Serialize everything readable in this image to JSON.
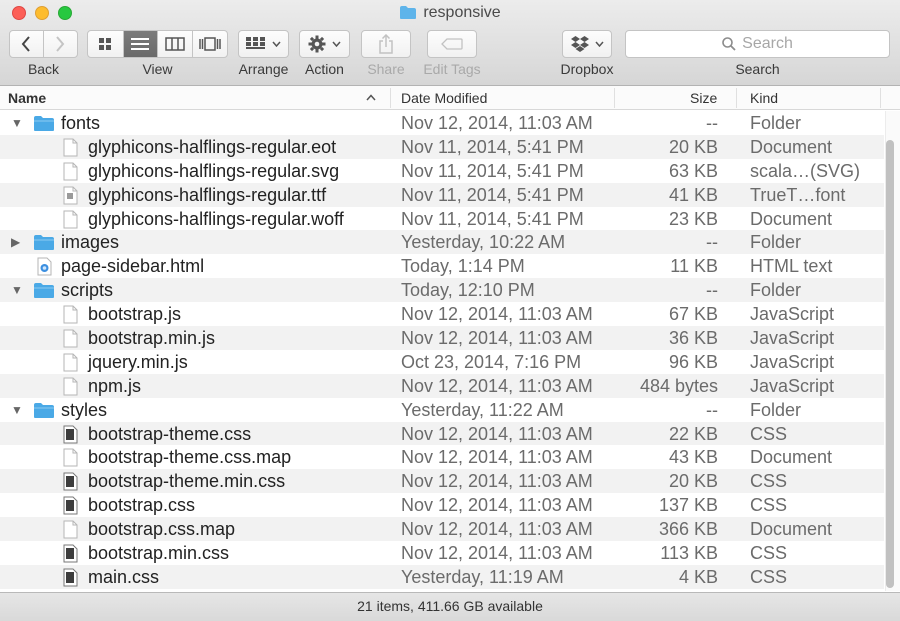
{
  "window": {
    "title": "responsive"
  },
  "toolbar": {
    "back_label": "Back",
    "view_label": "View",
    "arrange_label": "Arrange",
    "action_label": "Action",
    "share_label": "Share",
    "edit_tags_label": "Edit Tags",
    "dropbox_label": "Dropbox",
    "search_label": "Search",
    "search_placeholder": "Search",
    "view_mode_selected": "list"
  },
  "columns": {
    "name": "Name",
    "date_modified": "Date Modified",
    "size": "Size",
    "kind": "Kind",
    "sort": "name-ascending"
  },
  "rows": [
    {
      "name": "fonts",
      "date": "Nov 12, 2014, 11:03 AM",
      "size": "--",
      "kind": "Folder",
      "icon": "folder-icon",
      "depth": 0,
      "expanded": true
    },
    {
      "name": "glyphicons-halflings-regular.eot",
      "date": "Nov 11, 2014, 5:41 PM",
      "size": "20 KB",
      "kind": "Document",
      "icon": "document-icon",
      "depth": 1
    },
    {
      "name": "glyphicons-halflings-regular.svg",
      "date": "Nov 11, 2014, 5:41 PM",
      "size": "63 KB",
      "kind": "scala…(SVG)",
      "icon": "document-icon",
      "depth": 1
    },
    {
      "name": "glyphicons-halflings-regular.ttf",
      "date": "Nov 11, 2014, 5:41 PM",
      "size": "41 KB",
      "kind": "TrueT…font",
      "icon": "font-file-icon",
      "depth": 1
    },
    {
      "name": "glyphicons-halflings-regular.woff",
      "date": "Nov 11, 2014, 5:41 PM",
      "size": "23 KB",
      "kind": "Document",
      "icon": "document-icon",
      "depth": 1
    },
    {
      "name": "images",
      "date": "Yesterday, 10:22 AM",
      "size": "--",
      "kind": "Folder",
      "icon": "folder-icon",
      "depth": 0,
      "expanded": false
    },
    {
      "name": "page-sidebar.html",
      "date": "Today, 1:14 PM",
      "size": "11 KB",
      "kind": "HTML text",
      "icon": "html-file-icon",
      "depth": 0
    },
    {
      "name": "scripts",
      "date": "Today, 12:10 PM",
      "size": "--",
      "kind": "Folder",
      "icon": "folder-icon",
      "depth": 0,
      "expanded": true
    },
    {
      "name": "bootstrap.js",
      "date": "Nov 12, 2014, 11:03 AM",
      "size": "67 KB",
      "kind": "JavaScript",
      "icon": "document-icon",
      "depth": 1
    },
    {
      "name": "bootstrap.min.js",
      "date": "Nov 12, 2014, 11:03 AM",
      "size": "36 KB",
      "kind": "JavaScript",
      "icon": "document-icon",
      "depth": 1
    },
    {
      "name": "jquery.min.js",
      "date": "Oct 23, 2014, 7:16 PM",
      "size": "96 KB",
      "kind": "JavaScript",
      "icon": "document-icon",
      "depth": 1
    },
    {
      "name": "npm.js",
      "date": "Nov 12, 2014, 11:03 AM",
      "size": "484 bytes",
      "kind": "JavaScript",
      "icon": "document-icon",
      "depth": 1
    },
    {
      "name": "styles",
      "date": "Yesterday, 11:22 AM",
      "size": "--",
      "kind": "Folder",
      "icon": "folder-icon",
      "depth": 0,
      "expanded": true
    },
    {
      "name": "bootstrap-theme.css",
      "date": "Nov 12, 2014, 11:03 AM",
      "size": "22 KB",
      "kind": "CSS",
      "icon": "css-file-icon",
      "depth": 1
    },
    {
      "name": "bootstrap-theme.css.map",
      "date": "Nov 12, 2014, 11:03 AM",
      "size": "43 KB",
      "kind": "Document",
      "icon": "document-icon",
      "depth": 1
    },
    {
      "name": "bootstrap-theme.min.css",
      "date": "Nov 12, 2014, 11:03 AM",
      "size": "20 KB",
      "kind": "CSS",
      "icon": "css-file-icon",
      "depth": 1
    },
    {
      "name": "bootstrap.css",
      "date": "Nov 12, 2014, 11:03 AM",
      "size": "137 KB",
      "kind": "CSS",
      "icon": "css-file-icon",
      "depth": 1
    },
    {
      "name": "bootstrap.css.map",
      "date": "Nov 12, 2014, 11:03 AM",
      "size": "366 KB",
      "kind": "Document",
      "icon": "document-icon",
      "depth": 1
    },
    {
      "name": "bootstrap.min.css",
      "date": "Nov 12, 2014, 11:03 AM",
      "size": "113 KB",
      "kind": "CSS",
      "icon": "css-file-icon",
      "depth": 1
    },
    {
      "name": "main.css",
      "date": "Yesterday, 11:19 AM",
      "size": "4 KB",
      "kind": "CSS",
      "icon": "css-file-icon",
      "depth": 1
    }
  ],
  "status": {
    "text": "21 items, 411.66 GB available"
  },
  "colors": {
    "folder": "#4aa9e6",
    "status_close": "#fc5f57",
    "status_min": "#fdbc2e",
    "status_max": "#27c840"
  }
}
